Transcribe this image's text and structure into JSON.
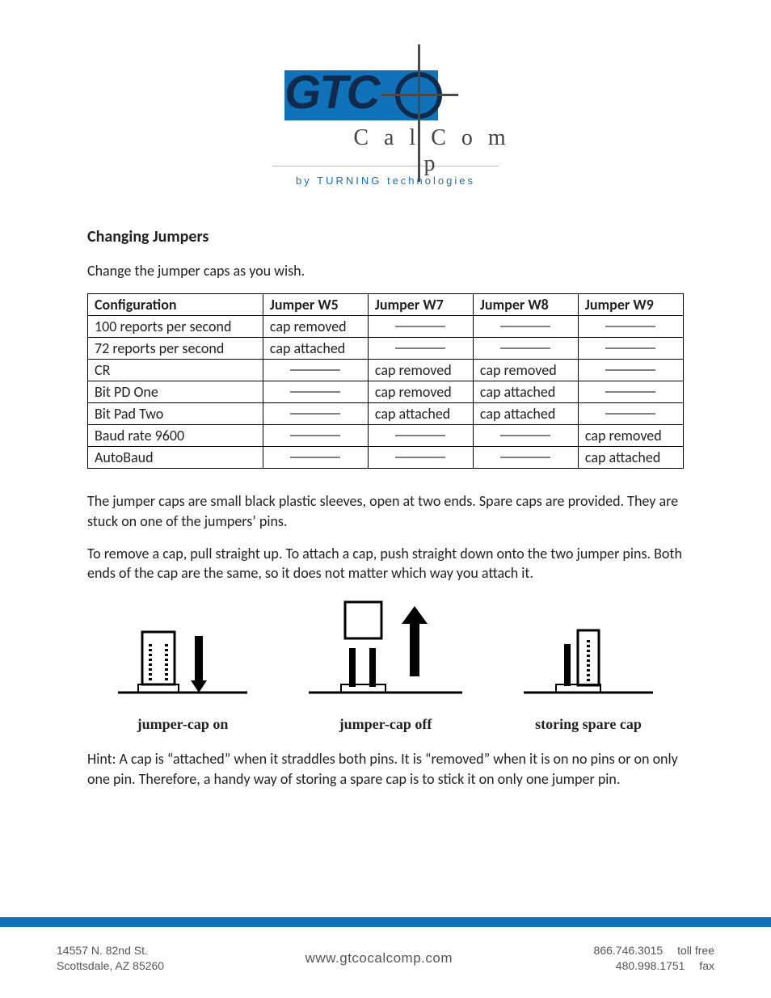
{
  "logo": {
    "brand_block": "GTC",
    "brand_serif": "C a l C o m p",
    "byline": "by  TURNING  technologies"
  },
  "heading": "Changing Jumpers",
  "intro": "Change the jumper caps as you wish.",
  "table": {
    "headers": [
      "Configuration",
      "Jumper W5",
      "Jumper W7",
      "Jumper W8",
      "Jumper W9"
    ],
    "rows": [
      {
        "config": "100 reports per second",
        "w5": "cap removed",
        "w7": "",
        "w8": "",
        "w9": ""
      },
      {
        "config": "72 reports per second",
        "w5": "cap attached",
        "w7": "",
        "w8": "",
        "w9": ""
      },
      {
        "config": "CR",
        "w5": "",
        "w7": "cap removed",
        "w8": "cap removed",
        "w9": ""
      },
      {
        "config": "Bit PD One",
        "w5": "",
        "w7": "cap removed",
        "w8": "cap attached",
        "w9": ""
      },
      {
        "config": "Bit Pad Two",
        "w5": "",
        "w7": "cap attached",
        "w8": "cap attached",
        "w9": ""
      },
      {
        "config": "Baud rate 9600",
        "w5": "",
        "w7": "",
        "w8": "",
        "w9": "cap removed"
      },
      {
        "config": "AutoBaud",
        "w5": "",
        "w7": "",
        "w8": "",
        "w9": "cap attached"
      }
    ]
  },
  "para1": "The jumper caps are small black plastic sleeves, open at two ends.  Spare caps are provided.  They are stuck on one of the jumpers’ pins.",
  "para2": "To remove a cap, pull straight up.  To attach a cap, push straight down onto the two jumper pins.  Both ends of the cap are the same, so it does not matter which way you attach it.",
  "diagram_labels": {
    "on": "jumper-cap on",
    "off": "jumper-cap off",
    "spare": "storing spare cap"
  },
  "hint": "Hint: A cap is “attached” when it straddles both pins.  It is “removed” when it is on no pins or on only one pin.  Therefore, a handy way of storing a spare cap is to stick it on only one jumper pin.",
  "footer": {
    "address_line1": "14557 N. 82nd St.",
    "address_line2": "Scottsdale, AZ 85260",
    "website": "www.gtcocalcomp.com",
    "phone_tollfree": "866.746.3015",
    "label_tollfree": "toll free",
    "phone_fax": "480.998.1751",
    "label_fax": "fax"
  }
}
